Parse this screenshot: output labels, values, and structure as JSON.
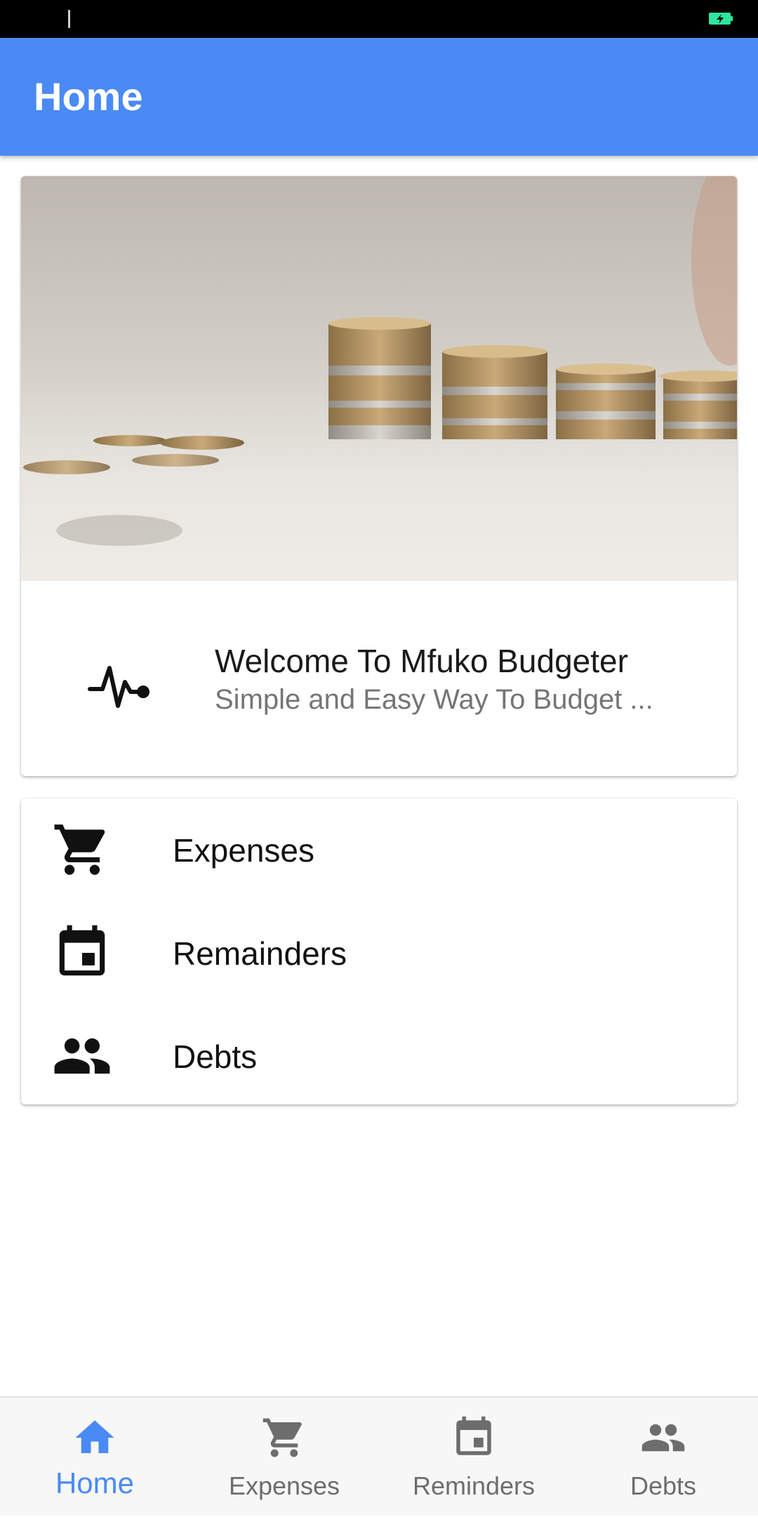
{
  "app_bar": {
    "title": "Home"
  },
  "welcome": {
    "icon": "pulse-icon",
    "title": "Welcome To Mfuko Budgeter",
    "subtitle": "Simple and Easy Way To Budget ..."
  },
  "menu": [
    {
      "icon": "cart-icon",
      "label": "Expenses"
    },
    {
      "icon": "calendar-icon",
      "label": "Remainders"
    },
    {
      "icon": "people-icon",
      "label": "Debts"
    }
  ],
  "bottom_nav": [
    {
      "icon": "home-icon",
      "label": "Home",
      "active": true
    },
    {
      "icon": "cart-icon",
      "label": "Expenses",
      "active": false
    },
    {
      "icon": "calendar-icon",
      "label": "Reminders",
      "active": false
    },
    {
      "icon": "people-icon",
      "label": "Debts",
      "active": false
    }
  ],
  "colors": {
    "primary": "#4a8af4",
    "status_bar": "#000000",
    "battery": "#2ee59d",
    "nav_inactive": "#6d6d6d"
  }
}
